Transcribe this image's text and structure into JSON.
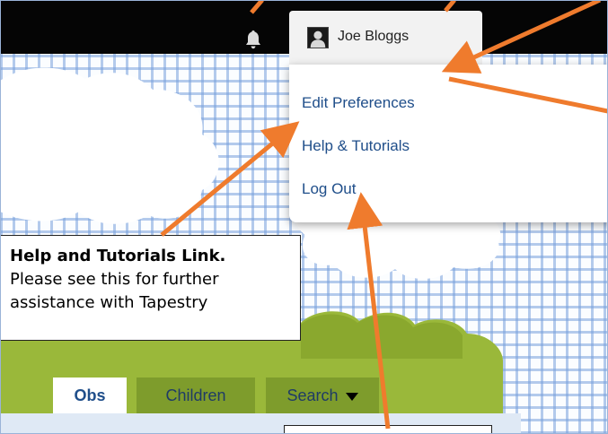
{
  "header": {
    "user_name": "Joe Bloggs"
  },
  "user_dropdown": {
    "items": [
      {
        "label": "Edit Preferences"
      },
      {
        "label": "Help & Tutorials"
      },
      {
        "label": "Log Out"
      }
    ]
  },
  "callout": {
    "title": "Help and Tutorials Link.",
    "body_line1": "Please see this for further",
    "body_line2": "assistance with Tapestry"
  },
  "nav_tabs": {
    "obs": "Obs",
    "children": "Children",
    "search": "Search"
  },
  "colors": {
    "header_bg": "#050505",
    "link": "#1f4e8a",
    "arrow": "#ef7b2d",
    "green": "#9ab83a",
    "tab_inactive": "#7e9c2c"
  },
  "icons": {
    "bell": "bell-icon",
    "avatar": "user-avatar-icon",
    "caret": "caret-down-icon"
  }
}
